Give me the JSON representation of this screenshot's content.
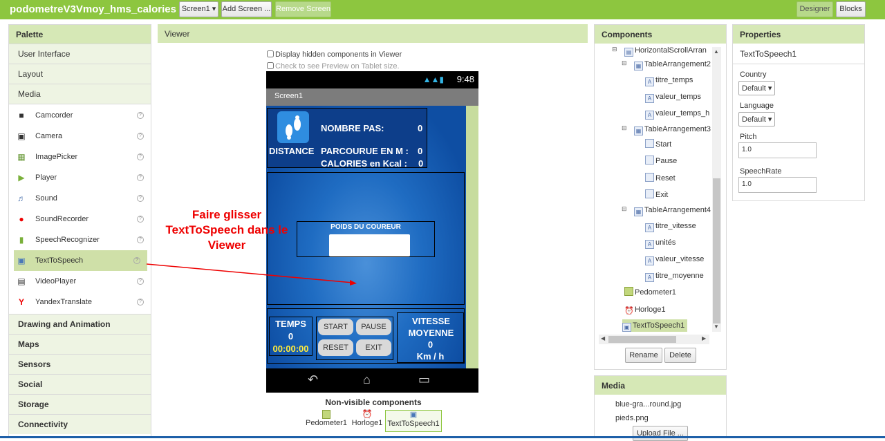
{
  "topbar": {
    "title": "podometreV3Vmoy_hms_calories",
    "screen_select": "Screen1 ▾",
    "add_screen": "Add Screen ...",
    "remove_screen": "Remove Screen",
    "designer": "Designer",
    "blocks": "Blocks"
  },
  "palette": {
    "title": "Palette",
    "categories_top": [
      "User Interface",
      "Layout",
      "Media"
    ],
    "media_items": [
      {
        "label": "Camcorder",
        "icon": "camcorder-icon"
      },
      {
        "label": "Camera",
        "icon": "camera-icon"
      },
      {
        "label": "ImagePicker",
        "icon": "imagepicker-icon"
      },
      {
        "label": "Player",
        "icon": "player-icon"
      },
      {
        "label": "Sound",
        "icon": "sound-icon"
      },
      {
        "label": "SoundRecorder",
        "icon": "soundrecorder-icon"
      },
      {
        "label": "SpeechRecognizer",
        "icon": "speechrecognizer-icon"
      },
      {
        "label": "TextToSpeech",
        "icon": "texttospeech-icon",
        "selected": true
      },
      {
        "label": "VideoPlayer",
        "icon": "videoplayer-icon"
      },
      {
        "label": "YandexTranslate",
        "icon": "yandextranslate-icon"
      }
    ],
    "categories_bottom": [
      "Drawing and Animation",
      "Maps",
      "Sensors",
      "Social",
      "Storage",
      "Connectivity"
    ],
    "help": "?"
  },
  "viewer": {
    "title": "Viewer",
    "chk_hidden": "Display hidden components in Viewer",
    "chk_tablet": "Check to see Preview on Tablet size.",
    "phone": {
      "time": "9:48",
      "screen_title": "Screen1",
      "nombre_pas_label": "NOMBRE PAS:",
      "nombre_pas_value": "0",
      "distance_label": "DISTANCE",
      "parcourue_label": "PARCOURUE EN M :",
      "parcourue_value": "0",
      "calories_label": "CALORIES en Kcal :",
      "calories_value": "0",
      "poids_label": "POIDS DU COUREUR",
      "temps_label": "TEMPS",
      "temps_value": "0",
      "temps_clock": "00:00:00",
      "start": "START",
      "pause": "PAUSE",
      "reset": "RESET",
      "exit": "EXIT",
      "vitesse_label": "VITESSE MOYENNE",
      "vitesse_value": "0",
      "vitesse_unit": "Km / h"
    },
    "annotation": "Faire glisser TextToSpeech dans le Viewer",
    "nonvisible_title": "Non-visible components",
    "nonvisible": [
      "Pedometer1",
      "Horloge1",
      "TextToSpeech1"
    ]
  },
  "components": {
    "title": "Components",
    "tree": [
      "HorizontalScrollArran",
      "TableArrangement2",
      "titre_temps",
      "valeur_temps",
      "valeur_temps_h",
      "TableArrangement3",
      "Start",
      "Pause",
      "Reset",
      "Exit",
      "TableArrangement4",
      "titre_vitesse",
      "unités",
      "valeur_vitesse",
      "titre_moyenne",
      "Pedometer1",
      "Horloge1",
      "TextToSpeech1"
    ],
    "rename": "Rename",
    "delete": "Delete"
  },
  "media": {
    "title": "Media",
    "files": [
      "blue-gra...round.jpg",
      "pieds.png"
    ],
    "upload": "Upload File ..."
  },
  "properties": {
    "title": "Properties",
    "component": "TextToSpeech1",
    "country_label": "Country",
    "country_value": "Default ▾",
    "language_label": "Language",
    "language_value": "Default ▾",
    "pitch_label": "Pitch",
    "pitch_value": "1.0",
    "speechrate_label": "SpeechRate",
    "speechrate_value": "1.0"
  },
  "colors": {
    "topbar": "#8dc63f",
    "panel_header": "#d6e8b6",
    "selected": "#cfe0a8",
    "annotation": "#ee0000",
    "phone_bg": "#0d4da0"
  }
}
